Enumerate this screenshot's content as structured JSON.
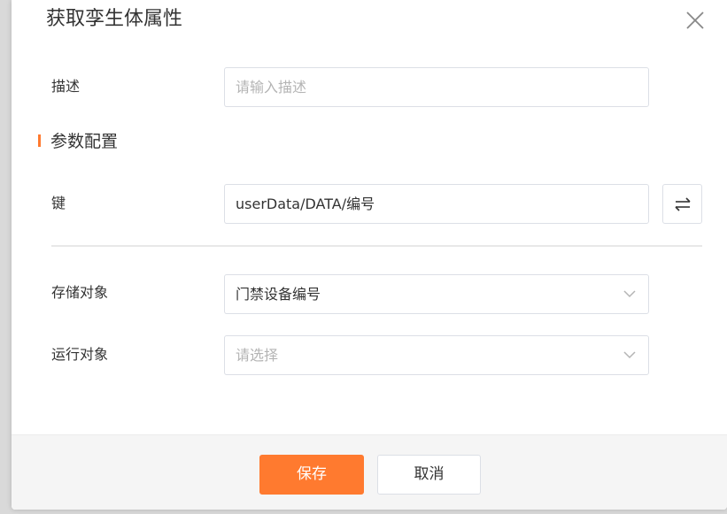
{
  "dialog": {
    "title": "获取孪生体属性"
  },
  "description": {
    "label": "描述",
    "placeholder": "请输入描述",
    "value": ""
  },
  "section": {
    "title": "参数配置"
  },
  "key": {
    "label": "键",
    "value": "userData/DATA/编号"
  },
  "storage": {
    "label": "存储对象",
    "value": "门禁设备编号"
  },
  "runtime": {
    "label": "运行对象",
    "placeholder": "请选择",
    "value": ""
  },
  "footer": {
    "save_label": "保存",
    "cancel_label": "取消"
  },
  "colors": {
    "accent": "#ff7a2f",
    "border": "#dcdfe6",
    "footer_bg": "#f5f5f5"
  },
  "icons": {
    "close": "close-icon",
    "swap": "swap-icon",
    "dropdown": "chevron-down-icon"
  }
}
